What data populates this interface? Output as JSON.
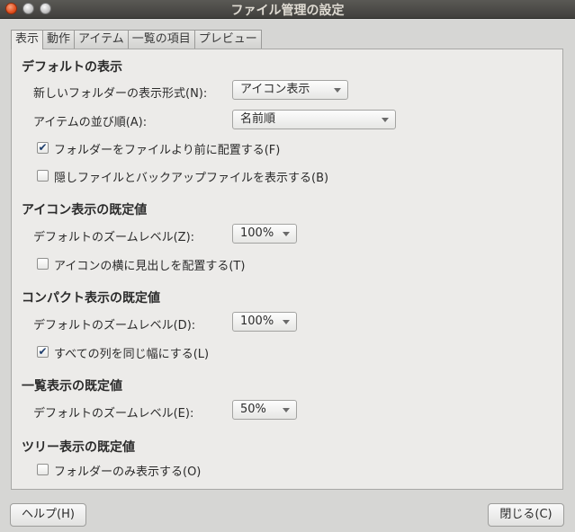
{
  "window": {
    "title": "ファイル管理の設定"
  },
  "tabs": [
    "表示",
    "動作",
    "アイテム",
    "一覧の項目",
    "プレビュー"
  ],
  "default_view": {
    "heading": "デフォルトの表示",
    "new_folder_label": "新しいフォルダーの表示形式(N):",
    "new_folder_value": "アイコン表示",
    "sort_label": "アイテムの並び順(A):",
    "sort_value": "名前順",
    "folders_first": {
      "label": "フォルダーをファイルより前に配置する(F)",
      "checked": true,
      "mark": "✔"
    },
    "show_hidden": {
      "label": "隠しファイルとバックアップファイルを表示する(B)",
      "checked": false,
      "mark": ""
    }
  },
  "icon_view": {
    "heading": "アイコン表示の既定値",
    "zoom_label": "デフォルトのズームレベル(Z):",
    "zoom_value": "100%",
    "beside": {
      "label": "アイコンの横に見出しを配置する(T)",
      "checked": false,
      "mark": ""
    }
  },
  "compact_view": {
    "heading": "コンパクト表示の既定値",
    "zoom_label": "デフォルトのズームレベル(D):",
    "zoom_value": "100%",
    "same_width": {
      "label": "すべての列を同じ幅にする(L)",
      "checked": true,
      "mark": "✔"
    }
  },
  "list_view": {
    "heading": "一覧表示の既定値",
    "zoom_label": "デフォルトのズームレベル(E):",
    "zoom_value": "50%"
  },
  "tree_view": {
    "heading": "ツリー表示の既定値",
    "folders_only": {
      "label": "フォルダーのみ表示する(O)",
      "checked": false,
      "mark": ""
    }
  },
  "buttons": {
    "help": "ヘルプ(H)",
    "close": "閉じる(C)"
  },
  "colors": {
    "titlebar": "#403f3c",
    "panel": "#ecebe9",
    "window_bg": "#d6d6d4",
    "check_mark": "#1f3f6e"
  }
}
